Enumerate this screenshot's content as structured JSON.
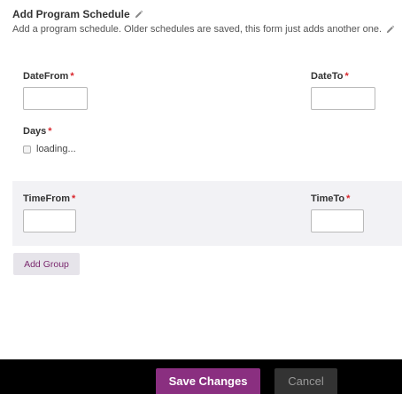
{
  "header": {
    "title": "Add Program Schedule",
    "description": "Add a program schedule. Older schedules are saved, this form just adds another one."
  },
  "fields": {
    "date_from_label": "DateFrom",
    "date_to_label": "DateTo",
    "days_label": "Days",
    "days_loading_text": "loading...",
    "time_from_label": "TimeFrom",
    "time_to_label": "TimeTo",
    "required_marker": "*"
  },
  "buttons": {
    "add_group": "Add Group",
    "save": "Save Changes",
    "cancel": "Cancel"
  },
  "colors": {
    "accent": "#8a2f80",
    "required": "#d9262c",
    "group_bg": "#f2f2f5",
    "footer_bg": "#000000"
  },
  "icons": [
    "pencil-icon",
    "checkbox-icon"
  ]
}
